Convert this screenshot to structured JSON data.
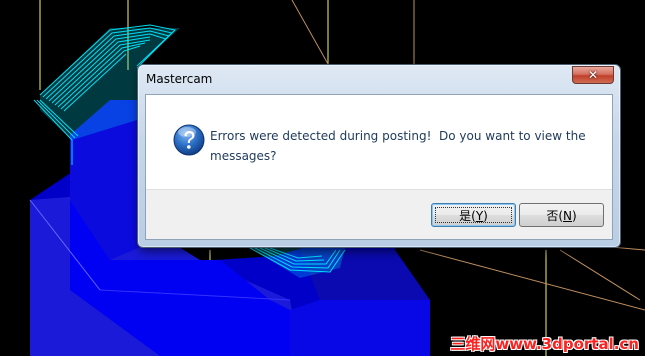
{
  "dialog": {
    "title": "Mastercam",
    "message": "Errors were detected during posting!  Do you want to view the messages?",
    "icon": "question-icon",
    "close_glyph": "✕",
    "buttons": {
      "yes": {
        "label_main": "是(",
        "mnemonic": "Y",
        "label_end": ")"
      },
      "no": {
        "label_main": "否(",
        "mnemonic": "N",
        "label_end": ")"
      }
    }
  },
  "watermark": {
    "text": "三维网www.3dportal.cn"
  },
  "colors": {
    "viewport_background": "#000000",
    "part_blue": "#0000ff",
    "toolpath_cyan": "#00e5ff",
    "guide_lines": "#ffff40",
    "watermark": "#ff2020"
  }
}
